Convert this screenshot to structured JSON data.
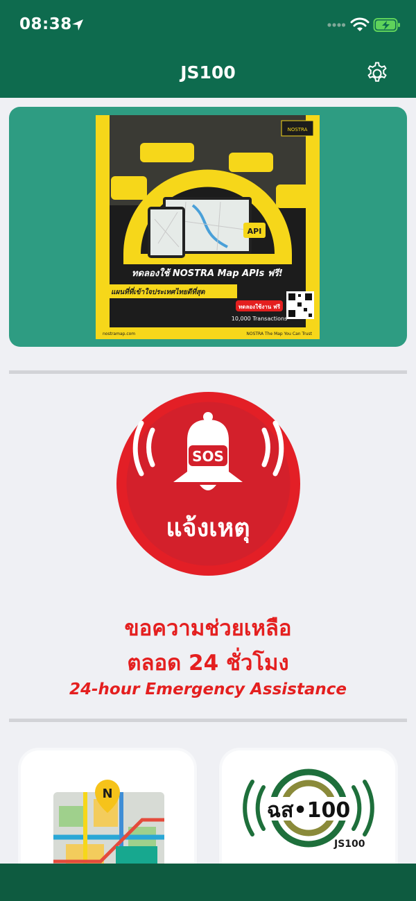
{
  "status": {
    "time": "08:38"
  },
  "header": {
    "title": "JS100",
    "settings_icon": "gear-icon"
  },
  "banner": {
    "brand": "NOSTRA",
    "headline": "ทดลองใช้ NOSTRA Map APIs ฟรี!",
    "subline": "แผนที่ที่เข้าใจประเทศไทยดีที่สุด",
    "trial": "ทดลองใช้งาน ฟรี",
    "transactions": "10,000 Transactions",
    "api_badge": "API",
    "footer_left": "nostramap.com",
    "footer_right": "NOSTRA The Map You Can Trust"
  },
  "sos": {
    "badge": "SOS",
    "label": "แจ้งเหตุ",
    "help_line1": "ขอความช่วยเหลือ",
    "help_line2": "ตลอด 24 ชั่วโมง",
    "help_line3": "24-hour Emergency Assistance"
  },
  "tiles": [
    {
      "name": "map",
      "icon": "map-icon",
      "pin_letter": "N"
    },
    {
      "name": "js100",
      "icon": "js100-logo-icon",
      "logo_text": "ฉส•100",
      "small_label": "JS100"
    }
  ],
  "colors": {
    "header": "#0e6b4e",
    "banner": "#2e9c82",
    "sos_red": "#e41f1f",
    "background": "#eff0f4"
  }
}
